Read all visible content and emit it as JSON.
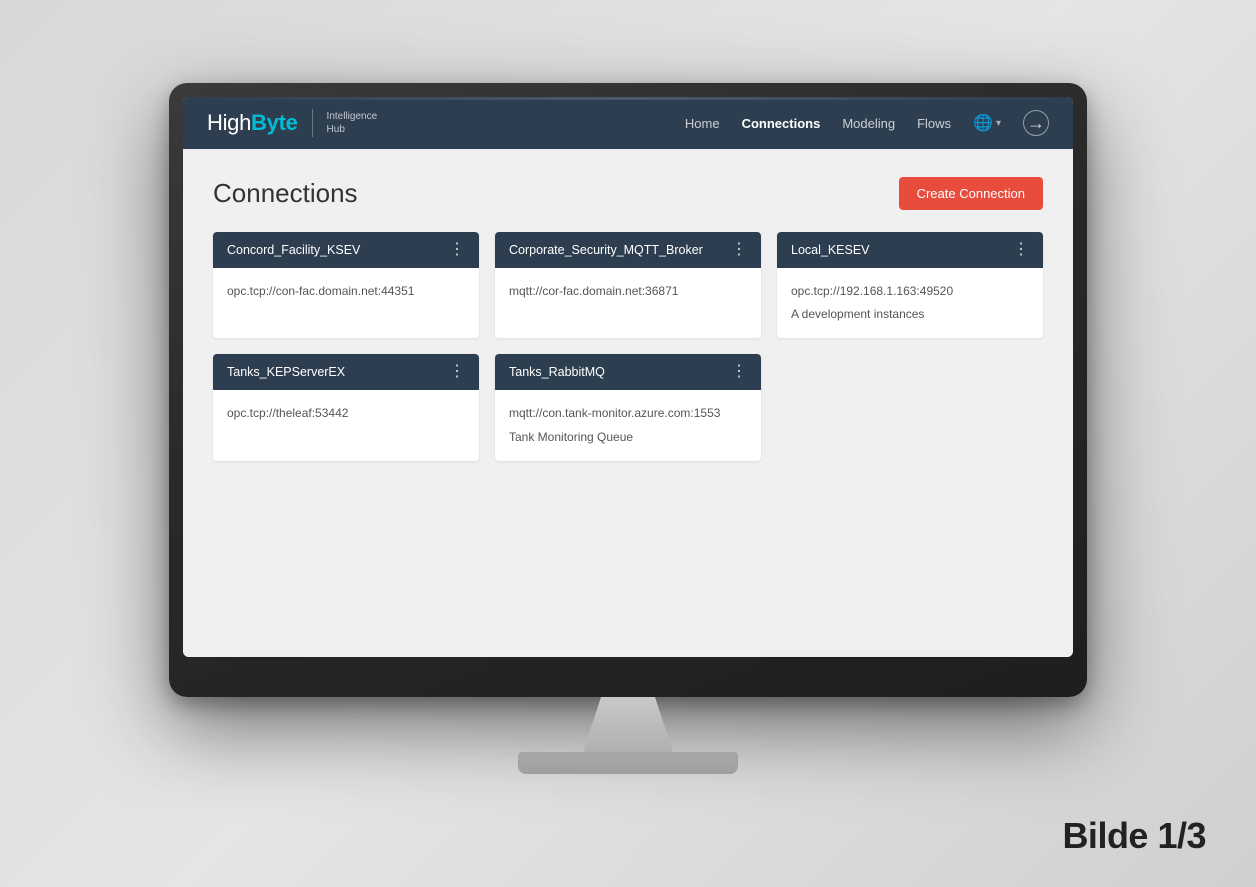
{
  "scene": {
    "bilde_label": "Bilde 1/3",
    "bg_color": "#e0e0e0"
  },
  "app": {
    "logo": {
      "high": "High",
      "byte": "Byte",
      "subtitle_line1": "Intelligence",
      "subtitle_line2": "Hub"
    },
    "nav": {
      "items": [
        {
          "label": "Home",
          "active": false
        },
        {
          "label": "Connections",
          "active": true
        },
        {
          "label": "Modeling",
          "active": false
        },
        {
          "label": "Flows",
          "active": false
        }
      ],
      "globe_icon": "🌐",
      "logout_icon": "→"
    },
    "page": {
      "title": "Connections",
      "create_button": "Create Connection"
    },
    "cards": [
      {
        "id": "card-1",
        "title": "Concord_Facility_KSEV",
        "details": [
          "opc.tcp://con-fac.domain.net:44351"
        ]
      },
      {
        "id": "card-2",
        "title": "Corporate_Security_MQTT_Broker",
        "details": [
          "mqtt://cor-fac.domain.net:36871"
        ]
      },
      {
        "id": "card-3",
        "title": "Local_KESEV",
        "details": [
          "opc.tcp://192.168.1.163:49520",
          "A development instances"
        ]
      },
      {
        "id": "card-4",
        "title": "Tanks_KEPServerEX",
        "details": [
          "opc.tcp://theleaf:53442"
        ]
      },
      {
        "id": "card-5",
        "title": "Tanks_RabbitMQ",
        "details": [
          "mqtt://con.tank-monitor.azure.com:1553",
          "Tank Monitoring Queue"
        ]
      }
    ],
    "menu_dots": "⋮"
  }
}
